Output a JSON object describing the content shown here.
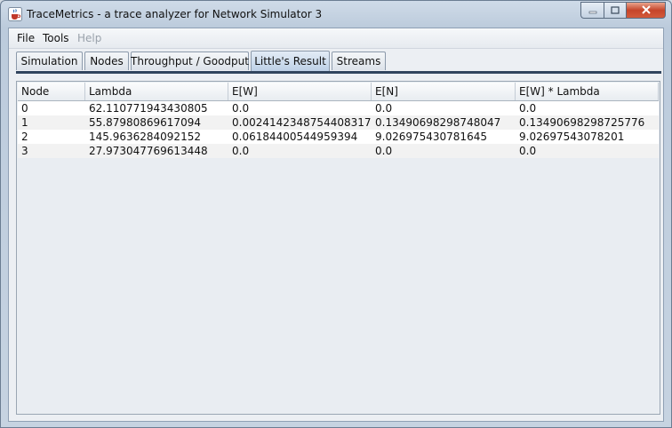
{
  "window": {
    "title": "TraceMetrics - a trace analyzer for Network Simulator 3"
  },
  "menu": {
    "file": "File",
    "tools": "Tools",
    "help": "Help"
  },
  "tabs": [
    "Simulation",
    "Nodes",
    "Throughput / Goodput",
    "Little's Result",
    "Streams"
  ],
  "active_tab": "Little's Result",
  "table": {
    "headers": [
      "Node",
      "Lambda",
      "E[W]",
      "E[N]",
      "E[W] * Lambda"
    ],
    "rows": [
      [
        "0",
        "62.110771943430805",
        "0.0",
        "0.0",
        "0.0"
      ],
      [
        "1",
        "55.87980869617094",
        "0.0024142348754408317",
        "0.13490698298748047",
        "0.13490698298725776"
      ],
      [
        "2",
        "145.9636284092152",
        "0.06184400544959394",
        "9.026975430781645",
        "9.02697543078201"
      ],
      [
        "3",
        "27.973047769613448",
        "0.0",
        "0.0",
        "0.0"
      ]
    ]
  },
  "icons": {
    "app": "java-cup-icon",
    "minimize": "minimize-icon",
    "maximize": "maximize-icon",
    "close": "close-icon"
  }
}
